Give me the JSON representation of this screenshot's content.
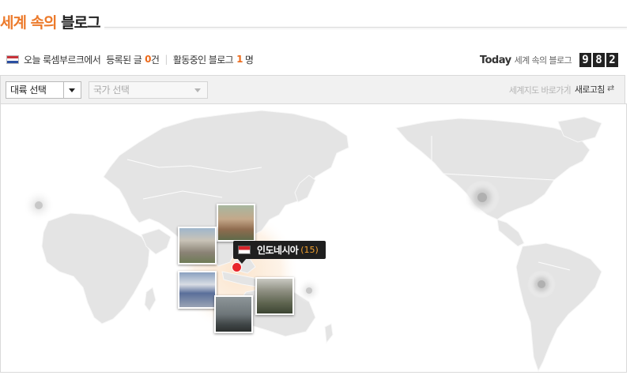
{
  "header": {
    "title_accent": "세계 속의",
    "title_rest": "블로그"
  },
  "stats": {
    "country_label": "오늘 룩셈부르크에서",
    "posts_label": "등록된 글",
    "posts_count": "0",
    "posts_unit": "건",
    "bloggers_label": "활동중인 블로그",
    "bloggers_count": "1",
    "bloggers_unit": "명"
  },
  "today": {
    "label": "Today",
    "sublabel": "세계 속의 블로그",
    "digits": [
      "9",
      "8",
      "2"
    ]
  },
  "filters": {
    "continent": "대륙 선택",
    "country": "국가 선택",
    "worldmap_link": "세계지도 바로가기",
    "refresh": "새로고침"
  },
  "tooltip": {
    "country": "인도네시아",
    "count": "(15)"
  },
  "colors": {
    "accent": "#ec7a2b",
    "map_land": "#e4e4e4",
    "pin": "#e8262b"
  },
  "icons": {
    "flag_luxembourg": "flag-luxembourg-icon",
    "flag_indonesia": "flag-indonesia-icon",
    "dropdown": "chevron-down-icon",
    "refresh": "refresh-icon"
  }
}
